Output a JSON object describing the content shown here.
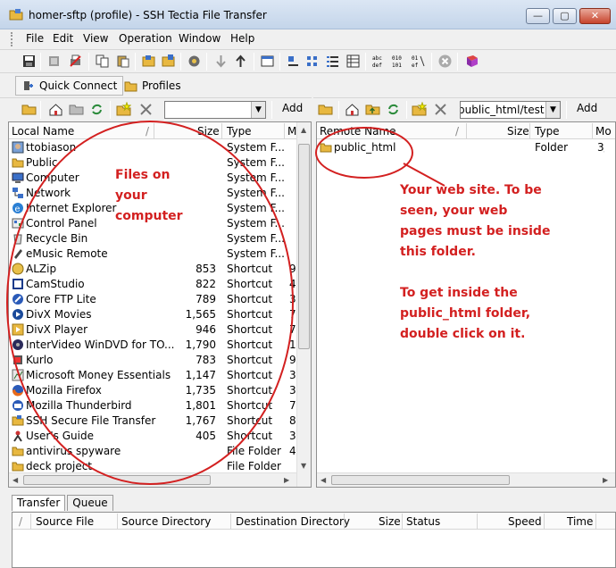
{
  "window": {
    "title": "homer-sftp (profile) - SSH Tectia File Transfer",
    "minimize": "—",
    "maximize": "▢",
    "close": "✕"
  },
  "menu": [
    "File",
    "Edit",
    "View",
    "Operation",
    "Window",
    "Help"
  ],
  "toolbar2": {
    "quick_connect": "Quick Connect",
    "profiles": "Profiles"
  },
  "left_bar": {
    "path": "",
    "add": "Add"
  },
  "right_bar": {
    "path": "public_html/test",
    "add": "Add"
  },
  "left_pane": {
    "columns": {
      "name": "Local Name",
      "sort": "/",
      "size": "Size",
      "type": "Type",
      "more": "M"
    },
    "rows": [
      {
        "name": "ttobiason",
        "size": "",
        "type": "System F...",
        "more": "",
        "icon": "user-folder-icon"
      },
      {
        "name": "Public",
        "size": "",
        "type": "System F...",
        "more": "",
        "icon": "folder-icon"
      },
      {
        "name": "Computer",
        "size": "",
        "type": "System F...",
        "more": "",
        "icon": "computer-icon"
      },
      {
        "name": "Network",
        "size": "",
        "type": "System F...",
        "more": "",
        "icon": "network-icon"
      },
      {
        "name": "Internet Explorer",
        "size": "",
        "type": "System F...",
        "more": "",
        "icon": "ie-icon"
      },
      {
        "name": "Control Panel",
        "size": "",
        "type": "System F...",
        "more": "",
        "icon": "control-panel-icon"
      },
      {
        "name": "Recycle Bin",
        "size": "",
        "type": "System F...",
        "more": "",
        "icon": "recycle-bin-icon"
      },
      {
        "name": "eMusic Remote",
        "size": "",
        "type": "System F...",
        "more": "",
        "icon": "music-icon"
      },
      {
        "name": "ALZip",
        "size": "853",
        "type": "Shortcut",
        "more": "9",
        "icon": "zip-icon"
      },
      {
        "name": "CamStudio",
        "size": "822",
        "type": "Shortcut",
        "more": "4",
        "icon": "camera-icon"
      },
      {
        "name": "Core FTP Lite",
        "size": "789",
        "type": "Shortcut",
        "more": "3",
        "icon": "ftp-icon"
      },
      {
        "name": "DivX Movies",
        "size": "1,565",
        "type": "Shortcut",
        "more": "7",
        "icon": "movie-icon"
      },
      {
        "name": "DivX Player",
        "size": "946",
        "type": "Shortcut",
        "more": "7",
        "icon": "player-icon"
      },
      {
        "name": "InterVideo WinDVD for TO...",
        "size": "1,790",
        "type": "Shortcut",
        "more": "1",
        "icon": "dvd-icon"
      },
      {
        "name": "Kurlo",
        "size": "783",
        "type": "Shortcut",
        "more": "9",
        "icon": "app-icon"
      },
      {
        "name": "Microsoft Money Essentials",
        "size": "1,147",
        "type": "Shortcut",
        "more": "3",
        "icon": "money-icon"
      },
      {
        "name": "Mozilla Firefox",
        "size": "1,735",
        "type": "Shortcut",
        "more": "3",
        "icon": "firefox-icon"
      },
      {
        "name": "Mozilla Thunderbird",
        "size": "1,801",
        "type": "Shortcut",
        "more": "7",
        "icon": "thunderbird-icon"
      },
      {
        "name": "SSH Secure File Transfer",
        "size": "1,767",
        "type": "Shortcut",
        "more": "8",
        "icon": "ssh-icon"
      },
      {
        "name": "User's Guide",
        "size": "405",
        "type": "Shortcut",
        "more": "3",
        "icon": "guide-icon"
      },
      {
        "name": "antivirus spyware",
        "size": "",
        "type": "File Folder",
        "more": "4",
        "icon": "folder-icon"
      },
      {
        "name": "deck project",
        "size": "",
        "type": "File Folder",
        "more": "",
        "icon": "folder-icon"
      }
    ]
  },
  "right_pane": {
    "columns": {
      "name": "Remote Name",
      "sort": "/",
      "size": "Size",
      "type": "Type",
      "more": "Mo"
    },
    "rows": [
      {
        "name": "public_html",
        "size": "",
        "type": "Folder",
        "more": "3/",
        "icon": "folder-icon"
      }
    ]
  },
  "bottom": {
    "tabs": [
      "Transfer",
      "Queue"
    ],
    "columns": [
      "/",
      "Source File",
      "Source Directory",
      "Destination Directory",
      "Size",
      "Status",
      "Speed",
      "Time"
    ]
  },
  "annotations": {
    "left": "Files on\nyour\ncomputer",
    "right1": "Your web site. To be\nseen, your web\npages must be inside\nthis folder.",
    "right2": "To get inside the\npublic_html folder,\ndouble click on it."
  },
  "colors": {
    "annotation": "#d32020",
    "folder": "#e8b840"
  }
}
